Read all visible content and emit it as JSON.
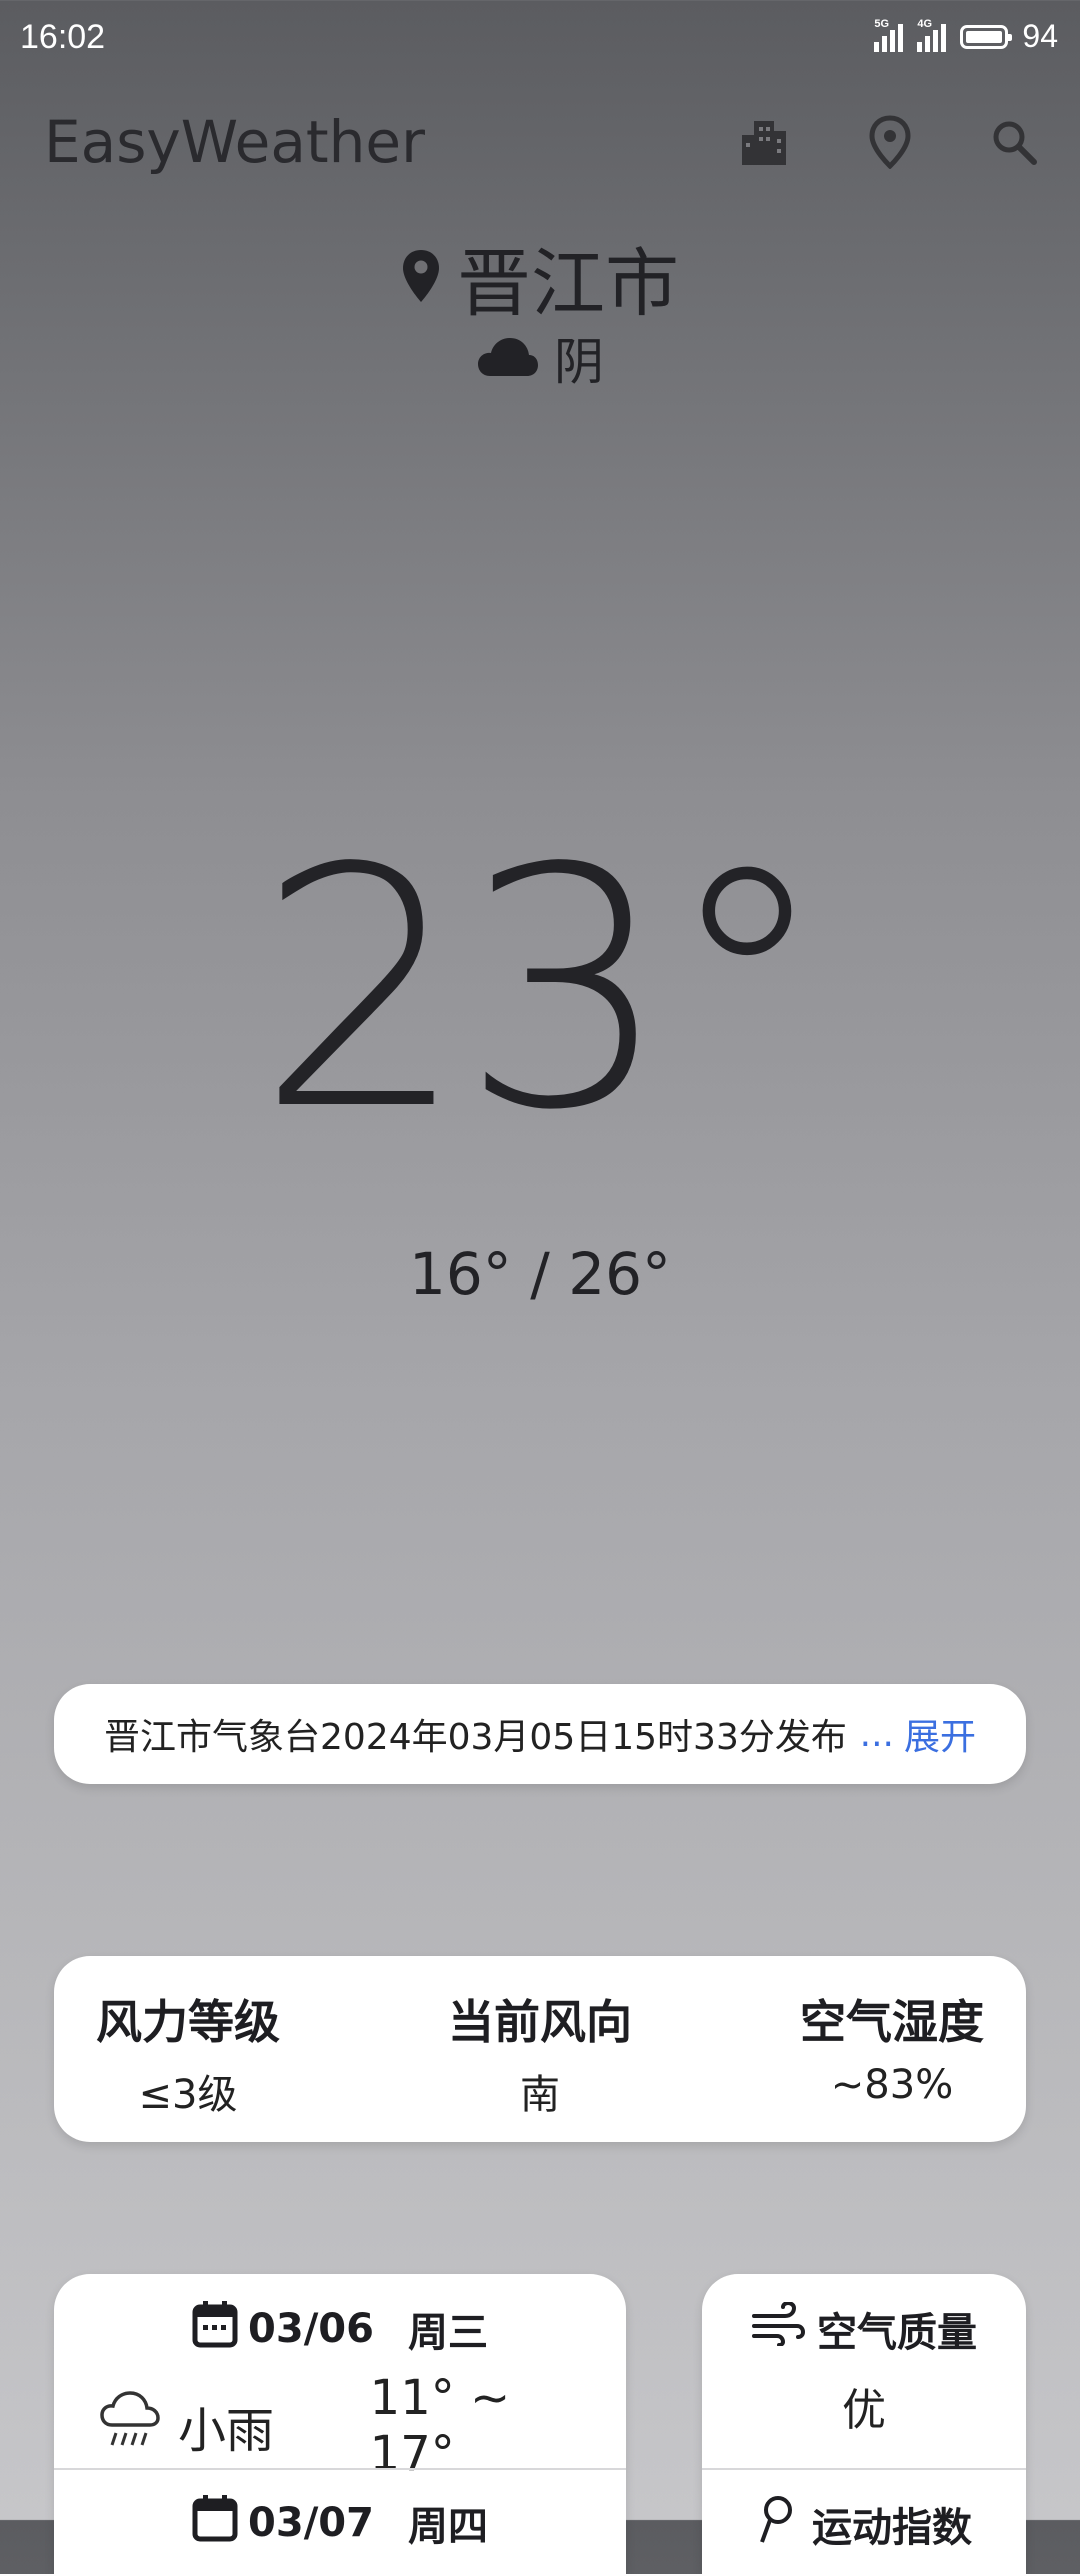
{
  "status_bar": {
    "time": "16:02",
    "signal1_tag": "5G",
    "signal2_tag": "4G",
    "battery": "94"
  },
  "app_bar": {
    "title": "EasyWeather",
    "icons": [
      "city-icon",
      "location-pin-icon",
      "search-icon"
    ]
  },
  "current": {
    "city": "晋江市",
    "condition": "阴",
    "temperature": "23°",
    "range": "16° / 26°"
  },
  "notice": {
    "text": "晋江市气象台2024年03月05日15时33分发布",
    "ellipsis": "...",
    "expand": "展开"
  },
  "wind": [
    {
      "label": "风力等级",
      "value": "≤3级"
    },
    {
      "label": "当前风向",
      "value": "南"
    },
    {
      "label": "空气湿度",
      "value": "~83%"
    }
  ],
  "forecast": [
    {
      "date": "03/06",
      "weekday": "周三",
      "desc": "小雨",
      "range": "11° ~ 17°"
    },
    {
      "date": "03/07",
      "weekday": "周四"
    }
  ],
  "air": {
    "label": "空气质量",
    "value": "优",
    "sport_label": "运动指数"
  },
  "colors": {
    "accent": "#3b6fe0",
    "card": "#ffffff",
    "text": "#222226"
  }
}
